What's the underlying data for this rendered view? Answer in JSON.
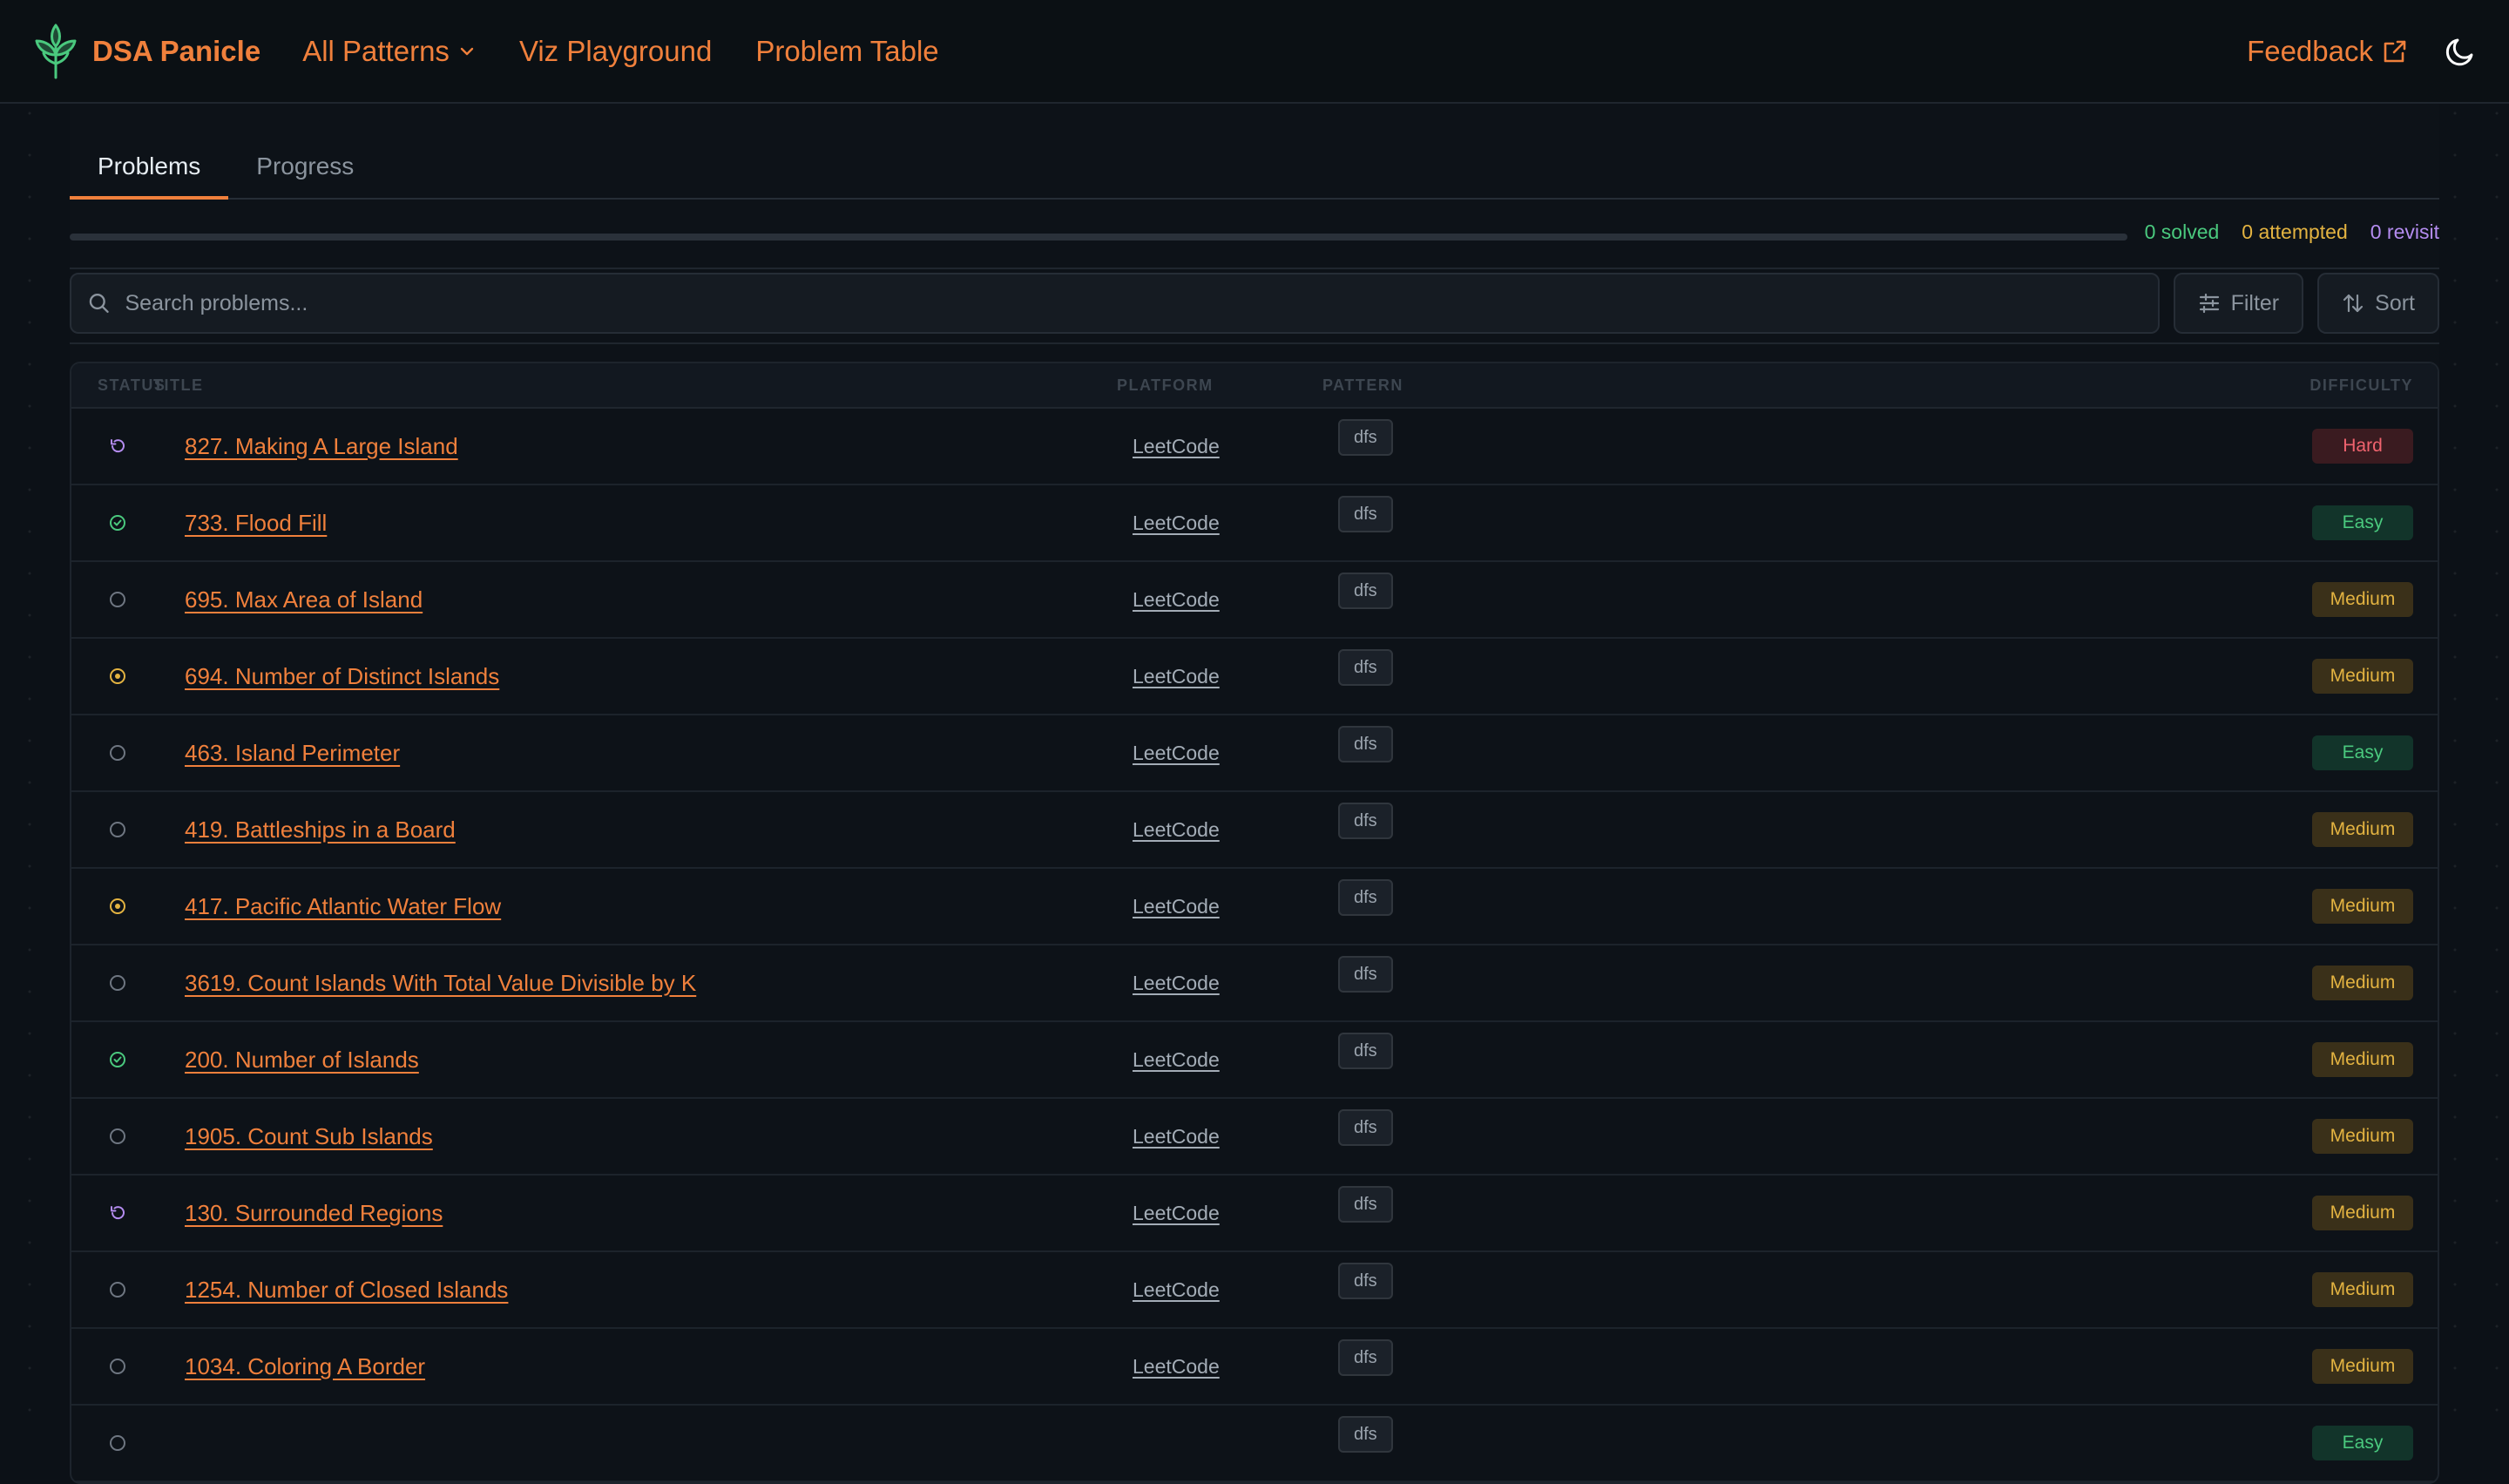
{
  "app": {
    "brand": "DSA Panicle",
    "nav": [
      {
        "label": "All Patterns",
        "has_dropdown": true
      },
      {
        "label": "Viz Playground"
      },
      {
        "label": "Problem Table"
      }
    ],
    "feedback": "Feedback",
    "theme_icon": "moon-icon",
    "accent_color": "#f0803c"
  },
  "tabs": [
    {
      "label": "Problems",
      "active": true
    },
    {
      "label": "Progress",
      "active": false
    }
  ],
  "stats": {
    "solved": "0 solved",
    "attempted": "0 attempted",
    "revisit": "0 revisit",
    "progress_fraction": 0
  },
  "search": {
    "placeholder": "Search problems..."
  },
  "buttons": {
    "filter": "Filter",
    "sort": "Sort"
  },
  "table": {
    "headers": {
      "status": "STATUS",
      "title": "TITLE",
      "platform": "PLATFORM",
      "pattern": "PATTERN",
      "difficulty": "DIFFICULTY"
    },
    "rows": [
      {
        "status": "revisit",
        "title": "827. Making A Large Island",
        "platform": "LeetCode",
        "pattern": "dfs",
        "difficulty": "Hard"
      },
      {
        "status": "solved",
        "title": "733. Flood Fill",
        "platform": "LeetCode",
        "pattern": "dfs",
        "difficulty": "Easy"
      },
      {
        "status": "todo",
        "title": "695. Max Area of Island",
        "platform": "LeetCode",
        "pattern": "dfs",
        "difficulty": "Medium"
      },
      {
        "status": "attempted",
        "title": "694. Number of Distinct Islands",
        "platform": "LeetCode",
        "pattern": "dfs",
        "difficulty": "Medium"
      },
      {
        "status": "todo",
        "title": "463. Island Perimeter",
        "platform": "LeetCode",
        "pattern": "dfs",
        "difficulty": "Easy"
      },
      {
        "status": "todo",
        "title": "419. Battleships in a Board",
        "platform": "LeetCode",
        "pattern": "dfs",
        "difficulty": "Medium"
      },
      {
        "status": "attempted",
        "title": "417. Pacific Atlantic Water Flow",
        "platform": "LeetCode",
        "pattern": "dfs",
        "difficulty": "Medium"
      },
      {
        "status": "todo",
        "title": "3619. Count Islands With Total Value Divisible by K",
        "platform": "LeetCode",
        "pattern": "dfs",
        "difficulty": "Medium"
      },
      {
        "status": "solved",
        "title": "200. Number of Islands",
        "platform": "LeetCode",
        "pattern": "dfs",
        "difficulty": "Medium"
      },
      {
        "status": "todo",
        "title": "1905. Count Sub Islands",
        "platform": "LeetCode",
        "pattern": "dfs",
        "difficulty": "Medium"
      },
      {
        "status": "revisit",
        "title": "130. Surrounded Regions",
        "platform": "LeetCode",
        "pattern": "dfs",
        "difficulty": "Medium"
      },
      {
        "status": "todo",
        "title": "1254. Number of Closed Islands",
        "platform": "LeetCode",
        "pattern": "dfs",
        "difficulty": "Medium"
      },
      {
        "status": "todo",
        "title": "1034. Coloring A Border",
        "platform": "LeetCode",
        "pattern": "dfs",
        "difficulty": "Medium"
      },
      {
        "status": "todo",
        "title": "",
        "platform": "",
        "pattern": "dfs",
        "difficulty": "Easy"
      }
    ]
  }
}
